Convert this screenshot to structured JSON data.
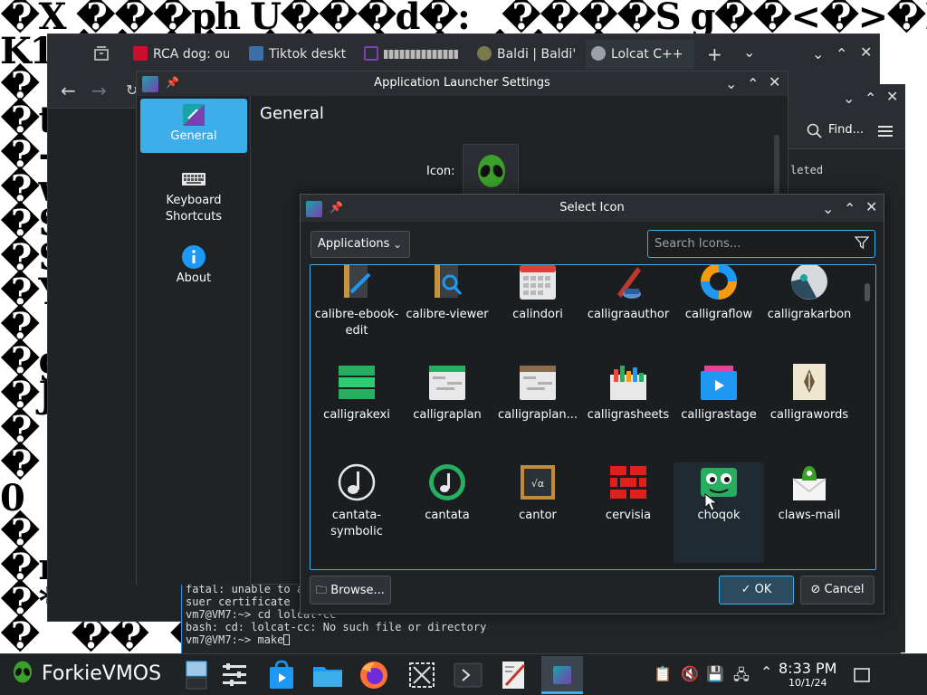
{
  "wallpaper": {
    "lines": [
      "�X ���ph U���d�:   ����S g��<�>�P D",
      "K1 �� ��  ��   �  �  ��  � Y2k",
      "�  ���   ���   �  �   ��   �  �",
      "�t�  ��  �   ��   ��   ��   �  �",
      "�-/�  ��  �  ��   ��  �  ��  ��",
      "�w�  ��  �  ��  �  ��  �  ��   �",
      "�SB  �� ��  ��  ��  ��  ��  ��",
      "�S?  �� ��  ��  ��  ��  ��  ��",
      "�Y�  ��  ��  ��  ��  ��  ��  ��",
      "�    ��  ��  ��  ��  ��  ��  ��",
      "�g�  ��  ��  ��  ��  ��  ��  ��",
      "�J�  ��  ��  ��  ��  ��  ��  ��",
      "�    ��  ��  ��  ��  ��  ��  ��",
      "�    ��  ��  ��  ��  ��  ��  ��",
      "0    ��  ��  ��  ��  ��  ��  ��",
      "�    ��  ��  ��  ��  ��  ��  ��",
      "�r   ��  ��  ��  ��  ��  ��  ��",
      "�*�)F    ��  ��  ��  ��  ��  (9",
      "�   ��  ��  ��  ��  ��  ��   ��"
    ]
  },
  "browser": {
    "tabs": [
      {
        "label": "RCA dog: our",
        "color": "#c8102e"
      },
      {
        "label": "Tiktok deskto",
        "color": "#3a6ea5"
      },
      {
        "label": "",
        "color": "#7a3fb0"
      },
      {
        "label": "Baldi | Baldi'",
        "color": "#7a7a4a"
      },
      {
        "label": "Lolcat C++",
        "color": "#9aa0a6"
      }
    ],
    "new_tab": "+",
    "tab_list": "⌄"
  },
  "console": {
    "find_label": "Find...",
    "deleted_text": "leted"
  },
  "terminal": {
    "lines": [
      "fatal: unable to a",
      "suer certificate",
      "vm7@VM7:~> cd lolcat-cc",
      "bash: cd: lolcat-cc: No such file or directory",
      "vm7@VM7:~> make"
    ]
  },
  "launcher": {
    "title": "Application Launcher Settings",
    "sidebar": [
      {
        "label": "General",
        "icon": "general-icon",
        "active": true
      },
      {
        "label": "Keyboard Shortcuts",
        "icon": "keyboard-icon",
        "active": false
      },
      {
        "label": "About",
        "icon": "info-icon",
        "active": false
      }
    ],
    "section_title": "General",
    "icon_label": "Icon:"
  },
  "dialog": {
    "title": "Select Icon",
    "category": "Applications",
    "search_placeholder": "Search Icons...",
    "browse_label": "Browse...",
    "ok_label": "OK",
    "cancel_label": "Cancel",
    "icons": [
      {
        "name": "calibre-ebook-edit",
        "label": "calibre-ebook-\nedit"
      },
      {
        "name": "calibre-viewer",
        "label": "calibre-viewer"
      },
      {
        "name": "calindori",
        "label": "calindori"
      },
      {
        "name": "calligraauthor",
        "label": "calligraauthor"
      },
      {
        "name": "calligraflow",
        "label": "calligraflow"
      },
      {
        "name": "calligrakarbon",
        "label": "calligrakarbon"
      },
      {
        "name": "calligrakexi",
        "label": "calligrakexi"
      },
      {
        "name": "calligraplan",
        "label": "calligraplan"
      },
      {
        "name": "calligraplanwork",
        "label": "calligraplan..."
      },
      {
        "name": "calligrasheets",
        "label": "calligrasheets"
      },
      {
        "name": "calligrastage",
        "label": "calligrastage"
      },
      {
        "name": "calligrawords",
        "label": "calligrawords"
      },
      {
        "name": "cantata-symbolic",
        "label": "cantata-\nsymbolic"
      },
      {
        "name": "cantata",
        "label": "cantata"
      },
      {
        "name": "cantor",
        "label": "cantor"
      },
      {
        "name": "cervisia",
        "label": "cervisia"
      },
      {
        "name": "choqok",
        "label": "choqok"
      },
      {
        "name": "claws-mail",
        "label": "claws-mail"
      }
    ]
  },
  "taskbar": {
    "brand": "ForkieVMOS",
    "time": "8:33 PM",
    "date": "10/1/24"
  },
  "colors": {
    "accent": "#3daee9",
    "window_bg": "#202326",
    "titlebar_bg": "#2a2e32"
  }
}
